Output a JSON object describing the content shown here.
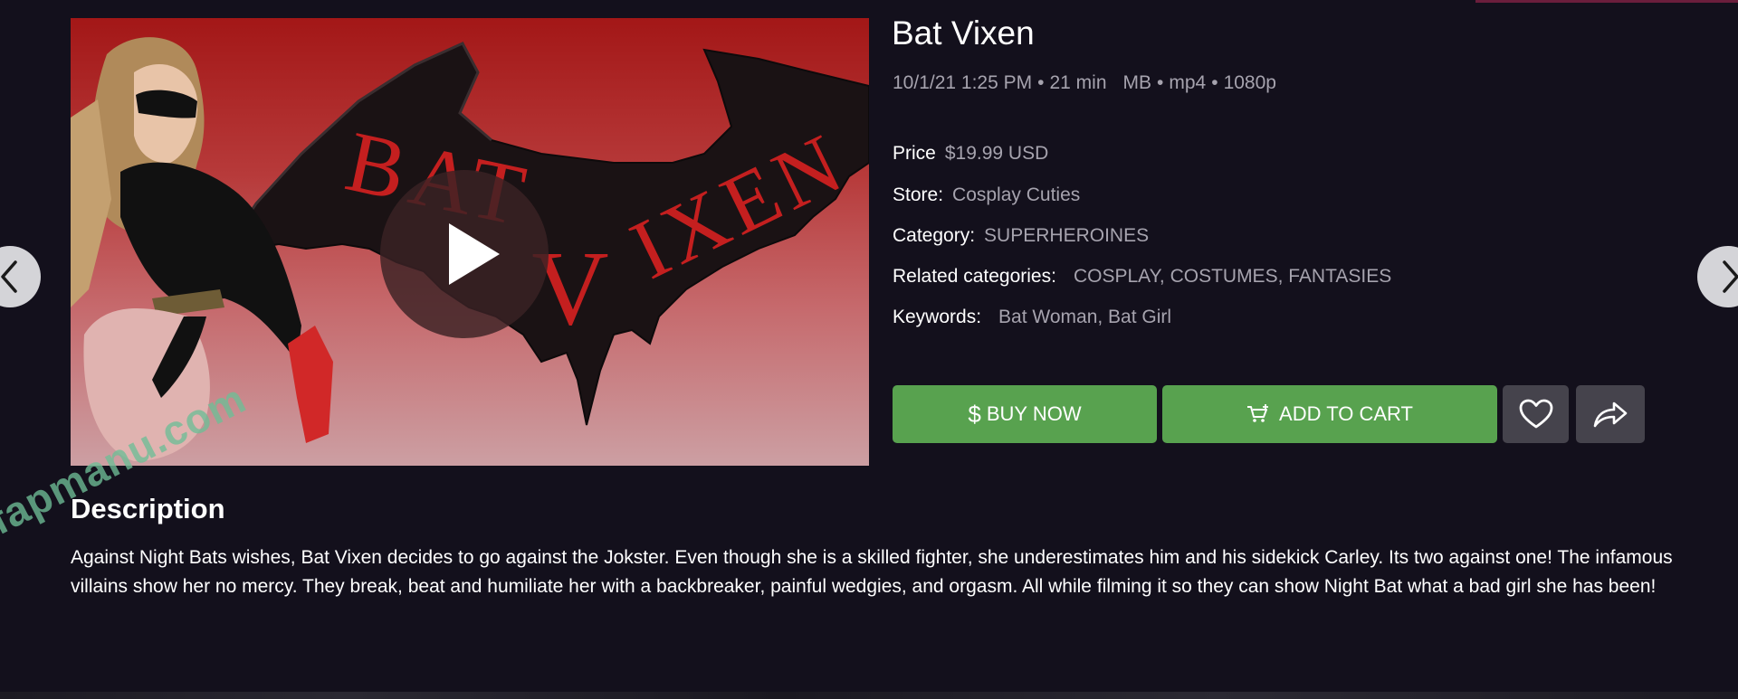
{
  "product": {
    "title": "Bat Vixen",
    "meta": {
      "datetime": "10/1/21 1:25 PM",
      "duration": "21 min",
      "size": "MB",
      "format": "mp4",
      "resolution": "1080p",
      "separator": "•"
    },
    "price": {
      "label": "Price",
      "value": "$19.99 USD"
    },
    "store": {
      "label": "Store:",
      "value": "Cosplay Cuties"
    },
    "category": {
      "label": "Category:",
      "value": "SUPERHEROINES"
    },
    "related": {
      "label": "Related categories:",
      "value": "COSPLAY, COSTUMES, FANTASIES"
    },
    "keywords": {
      "label": "Keywords:",
      "value": "Bat Woman, Bat Girl"
    }
  },
  "preview": {
    "logo_text_top": "BAT",
    "logo_text_right": "IXEN",
    "logo_letter_v": "V",
    "play_icon": "play-icon"
  },
  "actions": {
    "buy_symbol": "$",
    "buy_label": "BUY NOW",
    "cart_label": "ADD TO CART",
    "like_icon": "heart-icon",
    "share_icon": "share-icon"
  },
  "navigation": {
    "prev_icon": "chevron-left-icon",
    "next_icon": "chevron-right-icon"
  },
  "description": {
    "heading": "Description",
    "text": "Against Night Bats wishes, Bat Vixen decides to go against the Jokster. Even though she is a skilled fighter, she underestimates him and his sidekick Carley. Its two against one! The infamous villains show her no mercy. They break, beat and humiliate her with a backbreaker, painful wedgies, and orgasm. All while filming it so they can show Night Bat what a bad girl she has been!"
  },
  "watermark": {
    "text": "fapmanu.com"
  },
  "colors": {
    "background": "#13101c",
    "button_green": "#58a24f",
    "icon_button": "#45434c",
    "muted_text": "#a6a3ae",
    "logo_red": "#c41f1f"
  }
}
